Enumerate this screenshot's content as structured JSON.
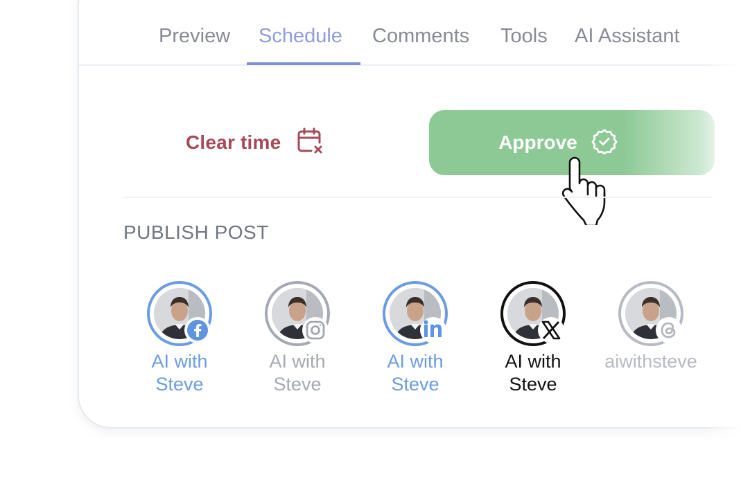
{
  "tabs": [
    {
      "label": "Preview",
      "active": false
    },
    {
      "label": "Schedule",
      "active": true
    },
    {
      "label": "Comments",
      "active": false
    },
    {
      "label": "Tools",
      "active": false
    },
    {
      "label": "AI Assistant",
      "active": false
    }
  ],
  "actions": {
    "clear_time_label": "Clear time",
    "clear_time_icon": "calendar-x-icon",
    "approve_label": "Approve",
    "approve_icon": "badge-check-icon"
  },
  "publish": {
    "title": "PUBLISH POST",
    "accounts": [
      {
        "line1": "AI with",
        "line2": "Steve",
        "network": "facebook",
        "color": "#6a9be4"
      },
      {
        "line1": "AI with",
        "line2": "Steve",
        "network": "instagram",
        "color": "#a5a9b3"
      },
      {
        "line1": "AI with",
        "line2": "Steve",
        "network": "linkedin",
        "color": "#6a9be4"
      },
      {
        "line1": "AI with",
        "line2": "Steve",
        "network": "x",
        "color": "#111111"
      },
      {
        "line1": "aiwithsteve",
        "line2": "",
        "network": "threads",
        "color": "#b6bac2"
      }
    ]
  },
  "colors": {
    "tab_active": "#8f9be2",
    "tab_inactive": "#878b96",
    "clear_time": "#a54a59",
    "approve_bg": "#8cc995"
  }
}
